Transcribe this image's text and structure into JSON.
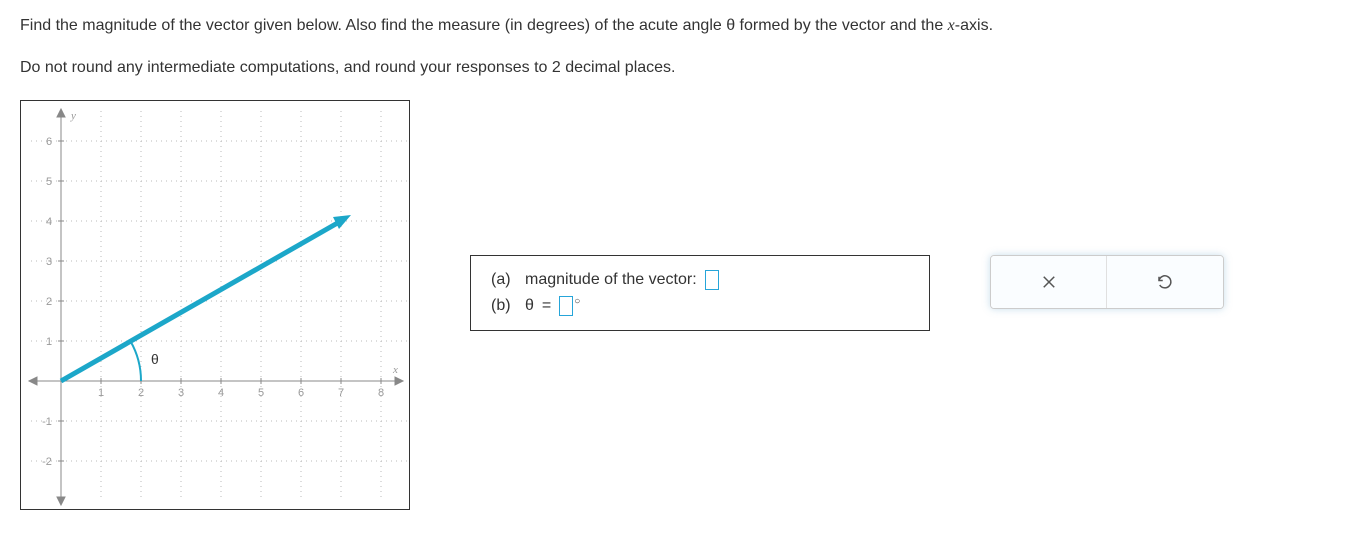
{
  "problem": {
    "line1_pre": "Find the magnitude of the vector given below. Also find the measure (in degrees) of the acute angle θ formed by the vector and the ",
    "line1_var": "x",
    "line1_post": "-axis.",
    "line2": "Do not round any intermediate computations, and round your responses to 2 decimal places."
  },
  "answers": {
    "a_tag": "(a)",
    "a_label": "magnitude of the vector:",
    "b_tag": "(b)",
    "b_theta": "θ",
    "b_eq": "="
  },
  "chart_data": {
    "type": "line",
    "x_range": [
      -0.5,
      8.5
    ],
    "y_range": [
      -2.8,
      6.8
    ],
    "x_ticks": [
      1,
      2,
      3,
      4,
      5,
      6,
      7,
      8
    ],
    "y_ticks": [
      -2,
      -1,
      1,
      2,
      3,
      4,
      5,
      6
    ],
    "axis_labels": {
      "x": "x",
      "y": "y"
    },
    "vector": {
      "start": [
        0,
        0
      ],
      "end": [
        7,
        4
      ]
    },
    "angle_arc": {
      "label": "θ",
      "radius": 2,
      "from_deg": 0,
      "to_deg": 29.74
    }
  }
}
